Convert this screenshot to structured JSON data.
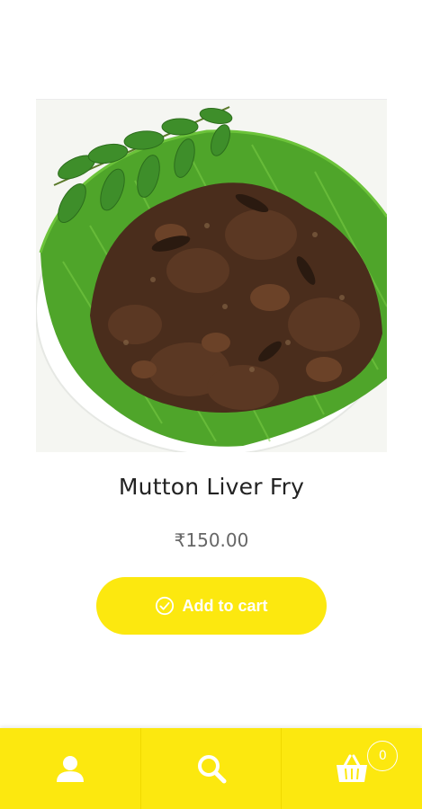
{
  "product": {
    "title": "Mutton Liver Fry",
    "price": "₹150.00",
    "image_alt": "Mutton Liver Fry on banana leaf"
  },
  "cart_button": {
    "label": "Add to cart",
    "icon": "check-circle-icon"
  },
  "bottom_nav": {
    "account_icon": "user-icon",
    "search_icon": "search-icon",
    "cart_icon": "basket-icon",
    "cart_count": "0"
  },
  "colors": {
    "accent": "#fce80f",
    "button_text": "#ffffff",
    "title_text": "#222222",
    "price_text": "#666666"
  }
}
